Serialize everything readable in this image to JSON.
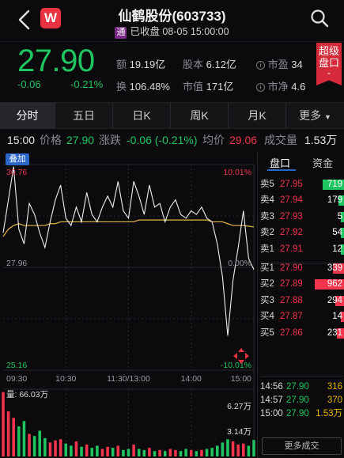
{
  "header": {
    "title": "仙鹤股份(603733)",
    "tong_badge": "通",
    "status": "已收盘 08-05 15:00:00",
    "logo_letter": "W"
  },
  "quote": {
    "price": "27.90",
    "change": "-0.06",
    "change_pct": "-0.21%",
    "turnover_label": "额",
    "turnover": "19.19亿",
    "equity_label": "股本",
    "equity": "6.12亿",
    "pe_label": "市盈",
    "pe": "34",
    "turn_rate_label": "换",
    "turn_rate": "106.48%",
    "mcap_label": "市值",
    "mcap": "171亿",
    "pb_label": "市净",
    "pb": "4.6",
    "super_tag_line1": "超级",
    "super_tag_line2": "盘口"
  },
  "tabs": [
    "分时",
    "五日",
    "日K",
    "周K",
    "月K",
    "更多"
  ],
  "inforow": {
    "time": "15:00",
    "price_label": "价格",
    "price": "27.90",
    "change_label": "涨跌",
    "change": "-0.06 (-0.21%)",
    "avg_label": "均价",
    "avg": "29.06",
    "volume_label": "成交量",
    "volume": "1.53万"
  },
  "chart": {
    "overlay_btn": "叠加",
    "y_high": "30.76",
    "y_mid": "27.96",
    "y_low": "25.16",
    "pct_high": "10.01%",
    "pct_mid": "0.00%",
    "pct_low": "-10.01%",
    "x_labels": [
      "09:30",
      "10:30",
      "11:30/13:00",
      "14:00",
      "15:00"
    ],
    "volume_label": "量: 66.03万",
    "vol_tick_high": "6.27万",
    "vol_tick_mid": "3.14万"
  },
  "chart_data": {
    "type": "line",
    "title": "",
    "xlabel": "",
    "ylabel": "",
    "ylim": [
      25.16,
      30.76
    ],
    "x": [
      "09:30",
      "09:35",
      "09:40",
      "09:45",
      "09:50",
      "09:55",
      "10:00",
      "10:05",
      "10:10",
      "10:15",
      "10:20",
      "10:25",
      "10:30",
      "10:35",
      "10:40",
      "10:45",
      "10:50",
      "10:55",
      "11:00",
      "11:05",
      "11:10",
      "11:15",
      "11:20",
      "11:25",
      "11:30",
      "13:05",
      "13:10",
      "13:15",
      "13:20",
      "13:25",
      "13:30",
      "13:35",
      "13:40",
      "13:45",
      "13:50",
      "13:55",
      "14:00",
      "14:05",
      "14:10",
      "14:15",
      "14:20",
      "14:25",
      "14:30",
      "14:35",
      "14:40",
      "14:45",
      "14:50",
      "14:55",
      "15:00"
    ],
    "series": [
      {
        "values": [
          28.9,
          29.8,
          30.7,
          29.0,
          28.6,
          29.7,
          29.4,
          28.9,
          28.5,
          29.2,
          29.8,
          30.2,
          29.3,
          29.1,
          29.6,
          29.2,
          30.0,
          29.4,
          29.2,
          29.6,
          29.9,
          29.6,
          30.3,
          29.5,
          29.3,
          30.3,
          29.9,
          29.4,
          30.2,
          29.6,
          29.7,
          29.2,
          29.6,
          29.8,
          29.4,
          29.3,
          29.5,
          29.4,
          29.6,
          29.3,
          29.2,
          28.6,
          27.7,
          26.1,
          27.6,
          28.5,
          29.5,
          28.2,
          27.9
        ]
      },
      {
        "values": [
          28.8,
          29.0,
          29.1,
          29.15,
          29.1,
          29.1,
          29.1,
          29.1,
          29.1,
          29.15,
          29.15,
          29.2,
          29.2,
          29.2,
          29.2,
          29.2,
          29.2,
          29.2,
          29.2,
          29.2,
          29.2,
          29.2,
          29.2,
          29.2,
          29.2,
          29.2,
          29.25,
          29.25,
          29.25,
          29.25,
          29.25,
          29.25,
          29.25,
          29.25,
          29.25,
          29.25,
          29.25,
          29.25,
          29.25,
          29.25,
          29.2,
          29.2,
          29.2,
          29.15,
          29.1,
          29.1,
          29.1,
          29.08,
          29.06
        ]
      }
    ],
    "colors": {
      "price": "#f0f0f0",
      "avg": "#e6b84c",
      "up": "#f2344d",
      "down": "#1fc560",
      "grid": "#2a2a2f"
    }
  },
  "volume_data": {
    "type": "bar",
    "unit": "万",
    "ylim": [
      0,
      6.27
    ],
    "values": [
      6.0,
      4.2,
      3.6,
      2.8,
      3.3,
      2.1,
      1.9,
      2.4,
      1.7,
      1.3,
      1.5,
      1.6,
      1.2,
      1.0,
      1.4,
      0.9,
      1.1,
      0.8,
      1.0,
      0.7,
      0.9,
      0.8,
      1.0,
      0.6,
      0.7,
      1.1,
      0.7,
      0.6,
      0.8,
      0.5,
      0.6,
      0.5,
      0.7,
      0.6,
      0.5,
      0.7,
      0.6,
      0.5,
      0.6,
      0.7,
      0.8,
      1.0,
      1.3,
      1.6,
      1.4,
      1.1,
      1.2,
      1.0,
      1.53
    ]
  },
  "right_panel": {
    "tab_active": "盘口",
    "tab_other": "资金",
    "order_book": [
      {
        "label": "卖5",
        "price": "27.95",
        "vol": "719",
        "color": "red",
        "bar": 0.45
      },
      {
        "label": "卖4",
        "price": "27.94",
        "vol": "179",
        "color": "red",
        "bar": 0.12
      },
      {
        "label": "卖3",
        "price": "27.93",
        "vol": "5",
        "color": "red",
        "bar": 0.03
      },
      {
        "label": "卖2",
        "price": "27.92",
        "vol": "54",
        "color": "red",
        "bar": 0.05
      },
      {
        "label": "卖1",
        "price": "27.91",
        "vol": "12",
        "color": "red",
        "bar": 0.03
      },
      {
        "label": "买1",
        "price": "27.90",
        "vol": "339",
        "color": "green",
        "bar": 0.23
      },
      {
        "label": "买2",
        "price": "27.89",
        "vol": "962",
        "color": "green",
        "bar": 0.62
      },
      {
        "label": "买3",
        "price": "27.88",
        "vol": "294",
        "color": "green",
        "bar": 0.19
      },
      {
        "label": "买4",
        "price": "27.87",
        "vol": "14",
        "color": "green",
        "bar": 0.03
      },
      {
        "label": "买5",
        "price": "27.86",
        "vol": "231",
        "color": "green",
        "bar": 0.15
      }
    ],
    "trades": [
      {
        "time": "14:56",
        "price": "27.90",
        "vol": "316"
      },
      {
        "time": "14:57",
        "price": "27.90",
        "vol": "370"
      },
      {
        "time": "15:00",
        "price": "27.90",
        "vol": "1.53万"
      }
    ],
    "more_trades": "更多成交"
  }
}
